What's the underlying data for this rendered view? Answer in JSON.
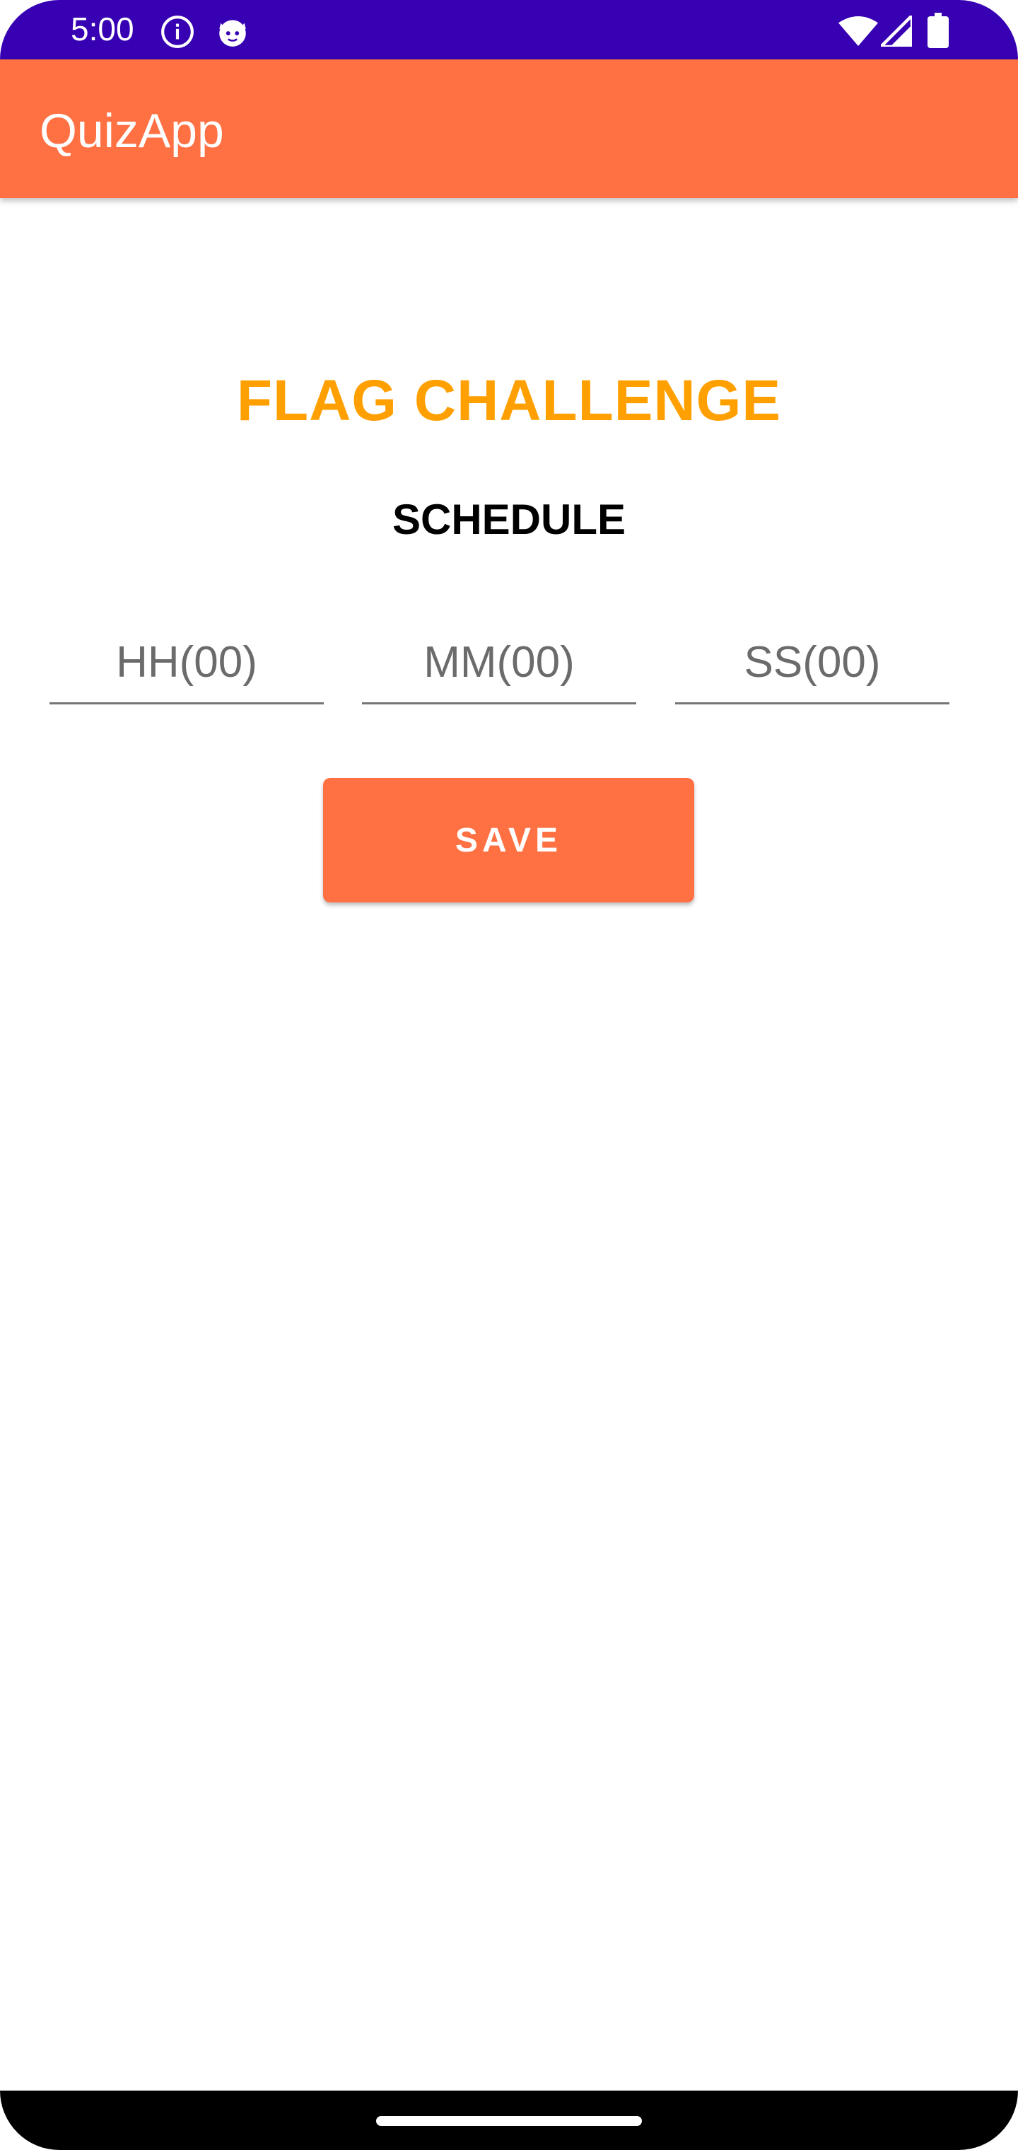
{
  "status_bar": {
    "time": "5:00",
    "icons_left": [
      "info-icon",
      "cat-notification-icon"
    ],
    "icons_right": [
      "wifi-icon",
      "cellular-signal-icon",
      "battery-icon"
    ],
    "background": "#3700b3"
  },
  "app_bar": {
    "title": "QuizApp",
    "background": "#ff7043"
  },
  "main": {
    "challenge_title": "FLAG CHALLENGE",
    "challenge_title_color": "#ffa000",
    "schedule_label": "SCHEDULE",
    "fields": {
      "hours_placeholder": "HH(00)",
      "minutes_placeholder": "MM(00)",
      "seconds_placeholder": "SS(00)"
    },
    "save_label": "SAVE",
    "save_color": "#ff7043"
  },
  "nav_bar": {
    "handle": "home-gesture-handle"
  }
}
